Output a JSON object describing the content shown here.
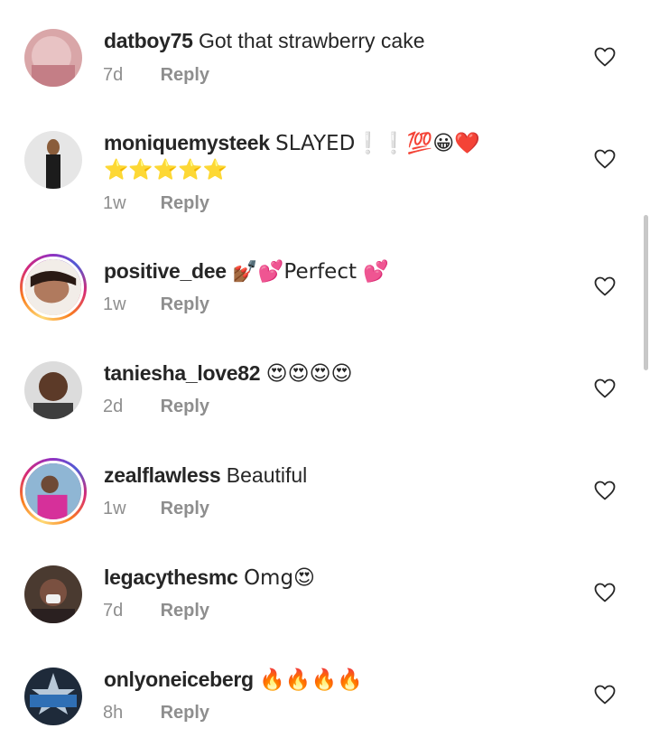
{
  "comments": [
    {
      "username": "datboy75",
      "text": "Got that strawberry cake",
      "time": "7d",
      "reply": "Reply"
    },
    {
      "username": "moniquemysteek",
      "text": "SLAYED❕❕💯😀❤️",
      "text2": "⭐⭐⭐⭐⭐",
      "time": "1w",
      "reply": "Reply"
    },
    {
      "username": "positive_dee",
      "text": "💅🏾💕Perfect 💕",
      "time": "1w",
      "reply": "Reply"
    },
    {
      "username": "taniesha_love82",
      "text": "😍😍😍😍",
      "time": "2d",
      "reply": "Reply"
    },
    {
      "username": "zealflawless",
      "text": "Beautiful",
      "time": "1w",
      "reply": "Reply"
    },
    {
      "username": "legacythesmc",
      "text": "Omg😍",
      "time": "7d",
      "reply": "Reply"
    },
    {
      "username": "onlyoneiceberg",
      "text": "🔥🔥🔥🔥",
      "time": "8h",
      "reply": "Reply"
    }
  ],
  "colors": {
    "text": "#262626",
    "meta": "#8e8e8e",
    "scrollbar": "#c8c8c8"
  },
  "icons": {
    "like": "heart-outline-icon"
  }
}
